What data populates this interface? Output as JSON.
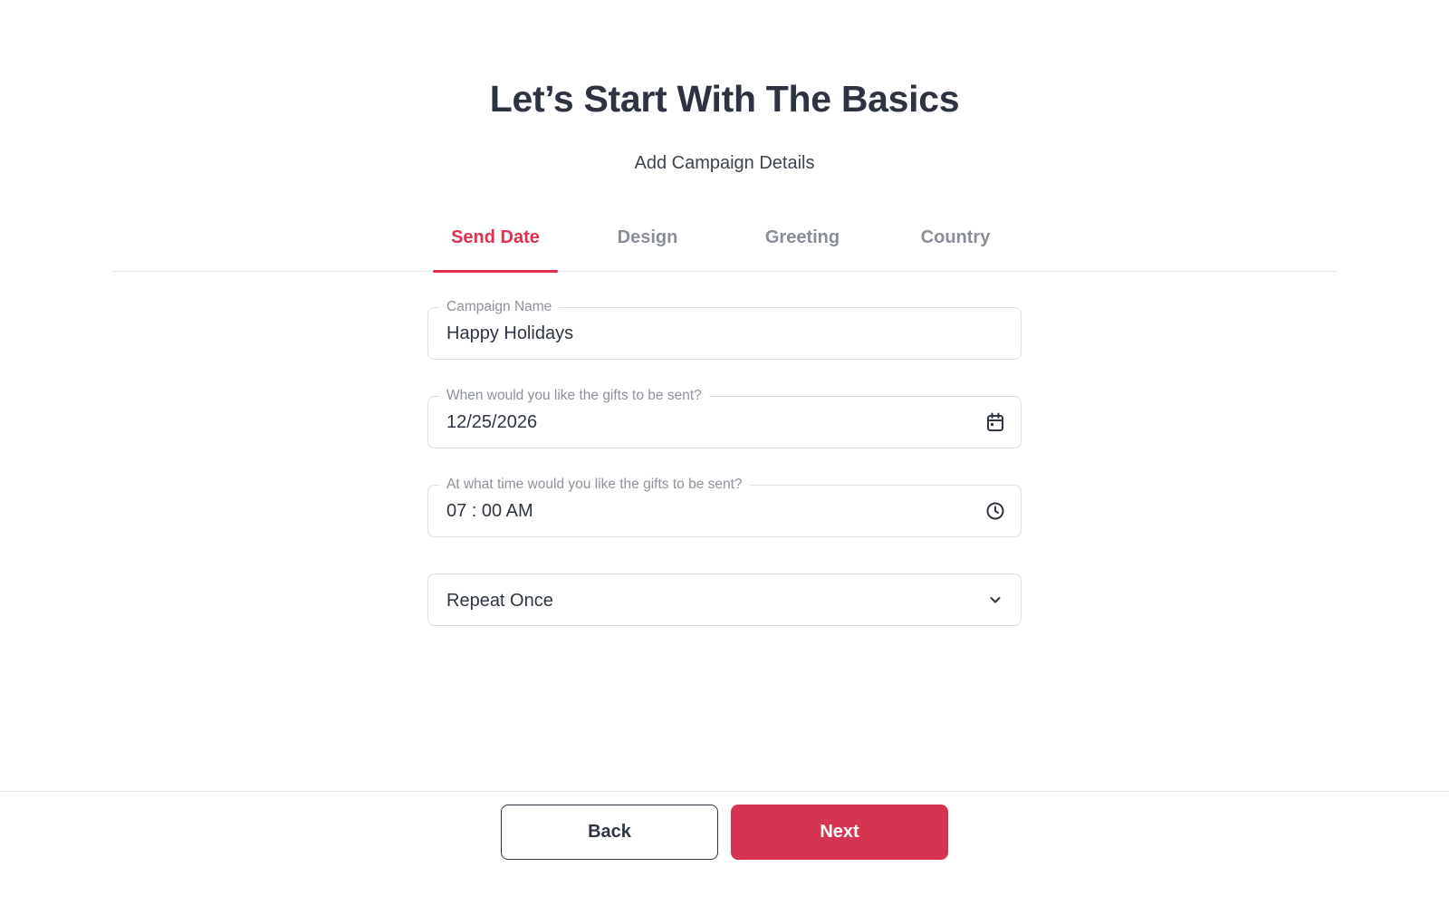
{
  "header": {
    "title": "Let’s Start With The Basics",
    "subtitle": "Add Campaign Details"
  },
  "tabs": [
    {
      "label": "Send Date",
      "active": true
    },
    {
      "label": "Design",
      "active": false
    },
    {
      "label": "Greeting",
      "active": false
    },
    {
      "label": "Country",
      "active": false
    }
  ],
  "form": {
    "campaign_name": {
      "label": "Campaign Name",
      "value": "Happy Holidays"
    },
    "send_date": {
      "label": "When would you like the gifts to be sent?",
      "value": "12/25/2026",
      "icon": "calendar-icon"
    },
    "send_time": {
      "label": "At what time would you like the gifts to be sent?",
      "value": "07 : 00 AM",
      "icon": "clock-icon"
    },
    "repeat": {
      "value": "Repeat Once",
      "icon": "chevron-down-icon"
    }
  },
  "footer": {
    "back_label": "Back",
    "next_label": "Next"
  },
  "colors": {
    "accent": "#e0304e",
    "button_primary": "#d63552",
    "text_dark": "#2f3542",
    "tab_inactive": "#8a8e99"
  }
}
